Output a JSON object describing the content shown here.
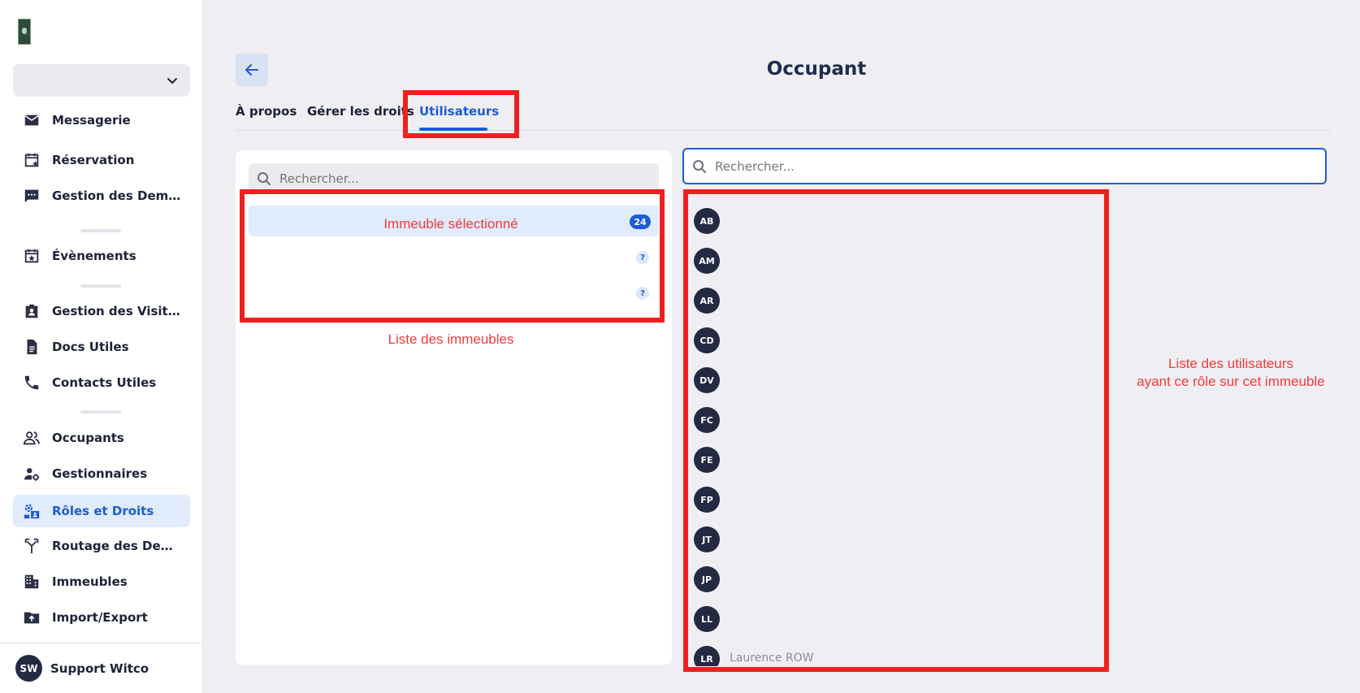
{
  "sidebar": {
    "nav": [
      {
        "label": "Messagerie",
        "icon": "mail-icon"
      },
      {
        "label": "Réservation",
        "icon": "calendar-plus-icon"
      },
      {
        "label": "Gestion des Demand...",
        "icon": "chat-icon"
      },
      {
        "label": "Évènements",
        "icon": "calendar-star-icon"
      },
      {
        "label": "Gestion des Visiteurs",
        "icon": "visitor-badge-icon"
      },
      {
        "label": "Docs Utiles",
        "icon": "document-icon"
      },
      {
        "label": "Contacts Utiles",
        "icon": "phone-icon"
      },
      {
        "label": "Occupants",
        "icon": "users-icon"
      },
      {
        "label": "Gestionnaires",
        "icon": "user-gear-icon"
      },
      {
        "label": "Rôles et Droits",
        "icon": "roles-icon"
      },
      {
        "label": "Routage des Deman...",
        "icon": "routing-icon"
      },
      {
        "label": "Immeubles",
        "icon": "building-icon"
      },
      {
        "label": "Import/Export",
        "icon": "folder-upload-icon"
      }
    ],
    "user": {
      "initials": "SW",
      "name": "Support Witco"
    }
  },
  "header": {
    "title": "Occupant",
    "tabs": [
      "À propos",
      "Gérer les droits",
      "Utilisateurs"
    ]
  },
  "buildings": {
    "search_placeholder": "Rechercher...",
    "items": [
      {
        "badge": "24"
      },
      {
        "badge": "?"
      },
      {
        "badge": "?"
      }
    ]
  },
  "users": {
    "search_placeholder": "Rechercher...",
    "initials": [
      "AB",
      "AM",
      "AR",
      "CD",
      "DV",
      "FC",
      "FE",
      "FP",
      "JT",
      "JP",
      "LL",
      "LR"
    ],
    "partial_text": "Laurence ROW"
  },
  "annotations": {
    "selected_building": "Immeuble sélectionné",
    "buildings_list": "Liste des immeubles",
    "users_list_line1": "Liste des utilisateurs",
    "users_list_line2": "ayant ce rôle sur cet immeuble"
  },
  "colors": {
    "accent": "#1f5bd8",
    "annotation": "#f11f1f",
    "avatar_bg": "#252a43",
    "selected_bg": "#e0ebfb"
  }
}
